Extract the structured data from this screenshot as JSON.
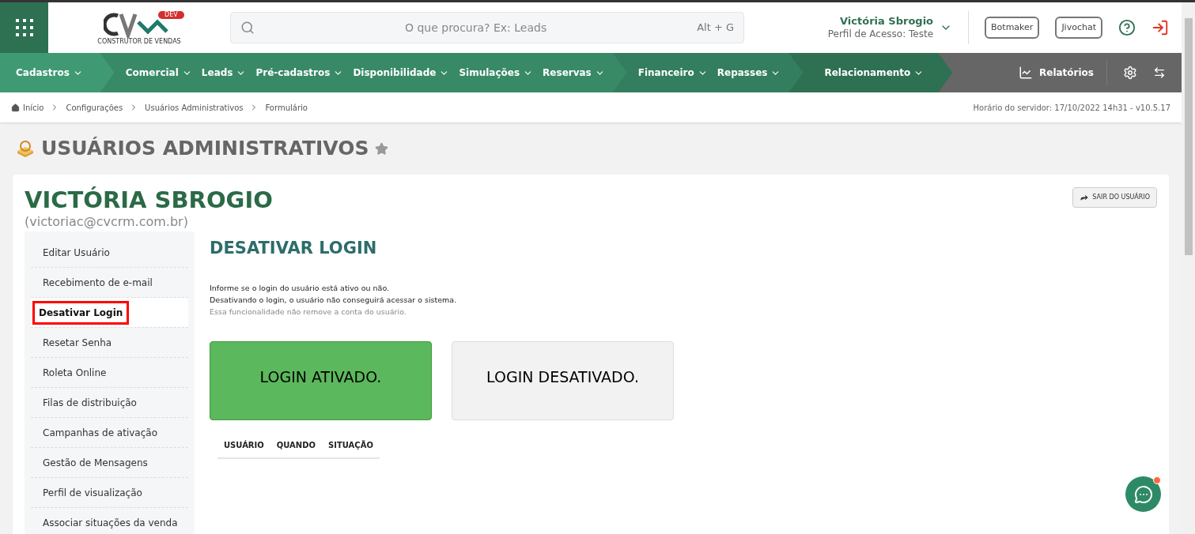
{
  "header": {
    "logo_badge": "DEV",
    "logo_tagline": "CONSTRUTOR DE VENDAS",
    "search": {
      "placeholder": "O que procura? Ex: Leads",
      "shortcut": "Alt + G"
    },
    "user": {
      "name": "Victória Sbrogio",
      "profile": "Perfil de Acesso: Teste"
    },
    "buttons": [
      "Botmaker",
      "Jivochat"
    ]
  },
  "nav": {
    "groups": [
      {
        "color": "#3f9a73",
        "items": [
          {
            "label": "Cadastros"
          }
        ]
      },
      {
        "color": "#388a66",
        "items": [
          {
            "label": "Comercial"
          },
          {
            "label": "Leads"
          },
          {
            "label": "Pré-cadastros"
          },
          {
            "label": "Disponibilidade"
          },
          {
            "label": "Simulações"
          },
          {
            "label": "Reservas"
          }
        ]
      },
      {
        "color": "#337e5e",
        "items": [
          {
            "label": "Financeiro"
          },
          {
            "label": "Repasses"
          }
        ]
      },
      {
        "color": "#2e7052",
        "items": [
          {
            "label": "Relacionamento"
          }
        ]
      }
    ],
    "reports": "Relatórios"
  },
  "breadcrumb": [
    "Início",
    "Configurações",
    "Usuários Administrativos",
    "Formulário"
  ],
  "server_time": "Horário do servidor: 17/10/2022 14h31 - v10.5.17",
  "page_title": "USUÁRIOS ADMINISTRATIVOS",
  "user_card": {
    "name": "VICTÓRIA SBROGIO",
    "email": "(victoriac@cvcrm.com.br)",
    "exit_button": "SAIR DO USUÁRIO"
  },
  "sidebar": {
    "items": [
      {
        "label": "Editar Usuário",
        "selected": false
      },
      {
        "label": "Recebimento de e-mail",
        "selected": false
      },
      {
        "label": "Desativar Login",
        "selected": true
      },
      {
        "label": "Resetar Senha",
        "selected": false
      },
      {
        "label": "Roleta Online",
        "selected": false
      },
      {
        "label": "Filas de distribuição",
        "selected": false
      },
      {
        "label": "Campanhas de ativação",
        "selected": false
      },
      {
        "label": "Gestão de Mensagens",
        "selected": false
      },
      {
        "label": "Perfil de visualização",
        "selected": false
      },
      {
        "label": "Associar situações da venda",
        "selected": false
      }
    ]
  },
  "section": {
    "title": "DESATIVAR LOGIN",
    "lines": [
      "Informe se o login do usuário está ativo ou não.",
      "Desativando o login, o usuário não conseguirá acessar o sistema."
    ],
    "note": "Essa funcionalidade não remove a conta do usuário.",
    "options": [
      {
        "label": "LOGIN ATIVADO.",
        "selected": true
      },
      {
        "label": "LOGIN DESATIVADO.",
        "selected": false
      }
    ],
    "table": {
      "columns": [
        "USUÁRIO",
        "QUANDO",
        "SITUAÇÃO"
      ]
    }
  }
}
